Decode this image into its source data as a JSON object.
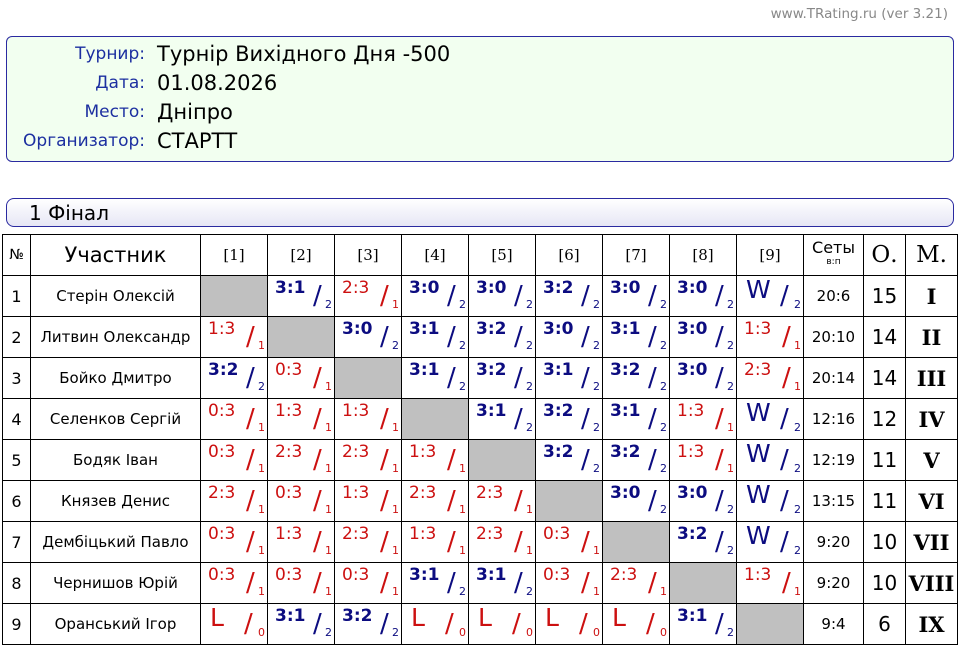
{
  "credit": "www.TRating.ru (ver 3.21)",
  "info": [
    {
      "label": "Турнир:",
      "value": "Турнір Вихідного Дня -500"
    },
    {
      "label": "Дата:",
      "value": "01.08.2026"
    },
    {
      "label": "Место:",
      "value": "Дніпро"
    },
    {
      "label": "Организатор:",
      "value": "СТАРТТ"
    }
  ],
  "group_title": "1 Фінал",
  "headers": {
    "num": "№",
    "name": "Участник",
    "cols": [
      "[1]",
      "[2]",
      "[3]",
      "[4]",
      "[5]",
      "[6]",
      "[7]",
      "[8]",
      "[9]"
    ],
    "sets": "Сеты",
    "sets_sub": "в:п",
    "points": "О.",
    "place": "М."
  },
  "players": [
    {
      "num": "1",
      "name": "Стерін Олексій",
      "results": [
        null,
        [
          "3:1",
          "2",
          "w"
        ],
        [
          "2:3",
          "1",
          "l"
        ],
        [
          "3:0",
          "2",
          "w"
        ],
        [
          "3:0",
          "2",
          "w"
        ],
        [
          "3:2",
          "2",
          "w"
        ],
        [
          "3:0",
          "2",
          "w"
        ],
        [
          "3:0",
          "2",
          "w"
        ],
        [
          "W",
          "2",
          "w"
        ]
      ],
      "sets": "20:6",
      "points": "15",
      "place": "I"
    },
    {
      "num": "2",
      "name": "Литвин Олександр",
      "results": [
        [
          "1:3",
          "1",
          "l"
        ],
        null,
        [
          "3:0",
          "2",
          "w"
        ],
        [
          "3:1",
          "2",
          "w"
        ],
        [
          "3:2",
          "2",
          "w"
        ],
        [
          "3:0",
          "2",
          "w"
        ],
        [
          "3:1",
          "2",
          "w"
        ],
        [
          "3:0",
          "2",
          "w"
        ],
        [
          "1:3",
          "1",
          "l"
        ]
      ],
      "sets": "20:10",
      "points": "14",
      "place": "II"
    },
    {
      "num": "3",
      "name": "Бойко Дмитро",
      "results": [
        [
          "3:2",
          "2",
          "w"
        ],
        [
          "0:3",
          "1",
          "l"
        ],
        null,
        [
          "3:1",
          "2",
          "w"
        ],
        [
          "3:2",
          "2",
          "w"
        ],
        [
          "3:1",
          "2",
          "w"
        ],
        [
          "3:2",
          "2",
          "w"
        ],
        [
          "3:0",
          "2",
          "w"
        ],
        [
          "2:3",
          "1",
          "l"
        ]
      ],
      "sets": "20:14",
      "points": "14",
      "place": "III"
    },
    {
      "num": "4",
      "name": "Селенков Сергій",
      "results": [
        [
          "0:3",
          "1",
          "l"
        ],
        [
          "1:3",
          "1",
          "l"
        ],
        [
          "1:3",
          "1",
          "l"
        ],
        null,
        [
          "3:1",
          "2",
          "w"
        ],
        [
          "3:2",
          "2",
          "w"
        ],
        [
          "3:1",
          "2",
          "w"
        ],
        [
          "1:3",
          "1",
          "l"
        ],
        [
          "W",
          "2",
          "w"
        ]
      ],
      "sets": "12:16",
      "points": "12",
      "place": "IV"
    },
    {
      "num": "5",
      "name": "Бодяк Іван",
      "results": [
        [
          "0:3",
          "1",
          "l"
        ],
        [
          "2:3",
          "1",
          "l"
        ],
        [
          "2:3",
          "1",
          "l"
        ],
        [
          "1:3",
          "1",
          "l"
        ],
        null,
        [
          "3:2",
          "2",
          "w"
        ],
        [
          "3:2",
          "2",
          "w"
        ],
        [
          "1:3",
          "1",
          "l"
        ],
        [
          "W",
          "2",
          "w"
        ]
      ],
      "sets": "12:19",
      "points": "11",
      "place": "V"
    },
    {
      "num": "6",
      "name": "Князев Денис",
      "results": [
        [
          "2:3",
          "1",
          "l"
        ],
        [
          "0:3",
          "1",
          "l"
        ],
        [
          "1:3",
          "1",
          "l"
        ],
        [
          "2:3",
          "1",
          "l"
        ],
        [
          "2:3",
          "1",
          "l"
        ],
        null,
        [
          "3:0",
          "2",
          "w"
        ],
        [
          "3:0",
          "2",
          "w"
        ],
        [
          "W",
          "2",
          "w"
        ]
      ],
      "sets": "13:15",
      "points": "11",
      "place": "VI"
    },
    {
      "num": "7",
      "name": "Дембіцький Павло",
      "results": [
        [
          "0:3",
          "1",
          "l"
        ],
        [
          "1:3",
          "1",
          "l"
        ],
        [
          "2:3",
          "1",
          "l"
        ],
        [
          "1:3",
          "1",
          "l"
        ],
        [
          "2:3",
          "1",
          "l"
        ],
        [
          "0:3",
          "1",
          "l"
        ],
        null,
        [
          "3:2",
          "2",
          "w"
        ],
        [
          "W",
          "2",
          "w"
        ]
      ],
      "sets": "9:20",
      "points": "10",
      "place": "VII"
    },
    {
      "num": "8",
      "name": "Чернишов Юрій",
      "results": [
        [
          "0:3",
          "1",
          "l"
        ],
        [
          "0:3",
          "1",
          "l"
        ],
        [
          "0:3",
          "1",
          "l"
        ],
        [
          "3:1",
          "2",
          "w"
        ],
        [
          "3:1",
          "2",
          "w"
        ],
        [
          "0:3",
          "1",
          "l"
        ],
        [
          "2:3",
          "1",
          "l"
        ],
        null,
        [
          "1:3",
          "1",
          "l"
        ]
      ],
      "sets": "9:20",
      "points": "10",
      "place": "VIII"
    },
    {
      "num": "9",
      "name": "Оранський Ігор",
      "results": [
        [
          "L",
          "0",
          "l"
        ],
        [
          "3:1",
          "2",
          "w"
        ],
        [
          "3:2",
          "2",
          "w"
        ],
        [
          "L",
          "0",
          "l"
        ],
        [
          "L",
          "0",
          "l"
        ],
        [
          "L",
          "0",
          "l"
        ],
        [
          "L",
          "0",
          "l"
        ],
        [
          "3:1",
          "2",
          "w"
        ],
        null
      ],
      "sets": "9:4",
      "points": "6",
      "place": "IX"
    }
  ]
}
